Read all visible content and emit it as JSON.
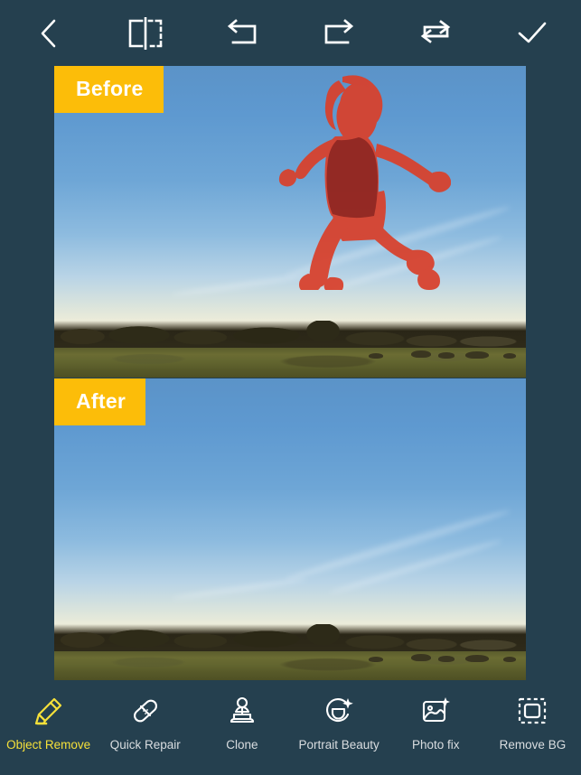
{
  "app": {
    "background_color": "#25404f",
    "accent_yellow": "#fcbd09",
    "active_label_color": "#f5e03a",
    "mask_color": "#e0402c"
  },
  "top_toolbar": {
    "buttons": [
      {
        "name": "back",
        "label": "Back",
        "icon": "chevron-left-icon"
      },
      {
        "name": "compare",
        "label": "Compare",
        "icon": "split-compare-icon"
      },
      {
        "name": "undo",
        "label": "Undo",
        "icon": "undo-arrow-icon"
      },
      {
        "name": "redo",
        "label": "Redo",
        "icon": "redo-arrow-icon"
      },
      {
        "name": "reset",
        "label": "Reset",
        "icon": "repeat-loop-icon"
      },
      {
        "name": "confirm",
        "label": "Done",
        "icon": "checkmark-icon"
      }
    ]
  },
  "editor": {
    "before_badge": "Before",
    "after_badge": "After",
    "before_image_alt": "Woman jumping in a field at sunset with red selection mask",
    "after_image_alt": "Field at sunset with the person removed"
  },
  "bottom_toolbar": {
    "tools": [
      {
        "label": "Object Remove",
        "icon": "eraser-pen-icon",
        "active": true
      },
      {
        "label": "Quick Repair",
        "icon": "bandage-icon",
        "active": false
      },
      {
        "label": "Clone",
        "icon": "stamp-icon",
        "active": false
      },
      {
        "label": "Portrait Beauty",
        "icon": "face-sparkle-icon",
        "active": false
      },
      {
        "label": "Photo fix",
        "icon": "photo-sparkle-icon",
        "active": false
      },
      {
        "label": "Remove BG",
        "icon": "dashed-square-icon",
        "active": false
      }
    ]
  }
}
